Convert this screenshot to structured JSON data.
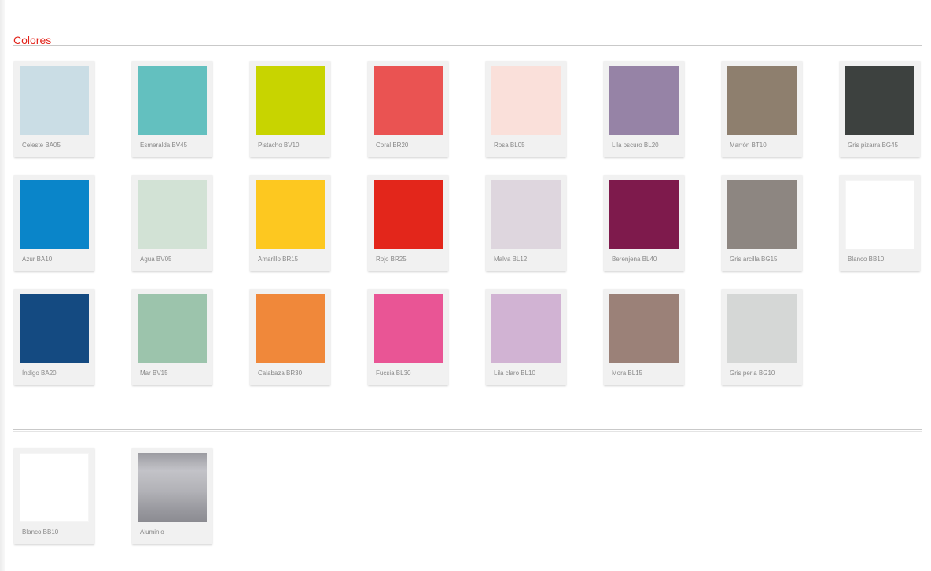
{
  "section": {
    "title": "Colores"
  },
  "colores": [
    {
      "label": "Celeste BA05",
      "color": "#cadde5"
    },
    {
      "label": "Esmeralda BV45",
      "color": "#63c0bf"
    },
    {
      "label": "Pistacho BV10",
      "color": "#c8d400"
    },
    {
      "label": "Coral BR20",
      "color": "#ea5352"
    },
    {
      "label": "Rosa BL05",
      "color": "#fae0da"
    },
    {
      "label": "Lila oscuro BL20",
      "color": "#9683a6"
    },
    {
      "label": "Marrón BT10",
      "color": "#8e7f6e"
    },
    {
      "label": "Gris pizarra BG45",
      "color": "#3d413f"
    },
    {
      "label": "Azur BA10",
      "color": "#0a85c9"
    },
    {
      "label": "Agua BV05",
      "color": "#d2e2d5"
    },
    {
      "label": "Amarillo BR15",
      "color": "#fdc820"
    },
    {
      "label": "Rojo BR25",
      "color": "#e3261b"
    },
    {
      "label": "Malva BL12",
      "color": "#ded6de"
    },
    {
      "label": "Berenjena BL40",
      "color": "#7e1a4c"
    },
    {
      "label": "Gris arcilla BG15",
      "color": "#8d8681"
    },
    {
      "label": "Blanco BB10",
      "color": "#ffffff"
    },
    {
      "label": "Índigo BA20",
      "color": "#144a81"
    },
    {
      "label": "Mar BV15",
      "color": "#9cc4ac"
    },
    {
      "label": "Calabaza BR30",
      "color": "#f0883a"
    },
    {
      "label": "Fucsia BL30",
      "color": "#e95595"
    },
    {
      "label": "Lila claro BL10",
      "color": "#d1b3d3"
    },
    {
      "label": "Mora BL15",
      "color": "#9b8178"
    },
    {
      "label": "Gris perla BG10",
      "color": "#d5d7d6"
    }
  ],
  "extra": [
    {
      "label": "Blanco BB10",
      "color": "#ffffff"
    },
    {
      "label": "Aluminio",
      "color": "#a8a8ad",
      "finish": "metallic"
    }
  ]
}
